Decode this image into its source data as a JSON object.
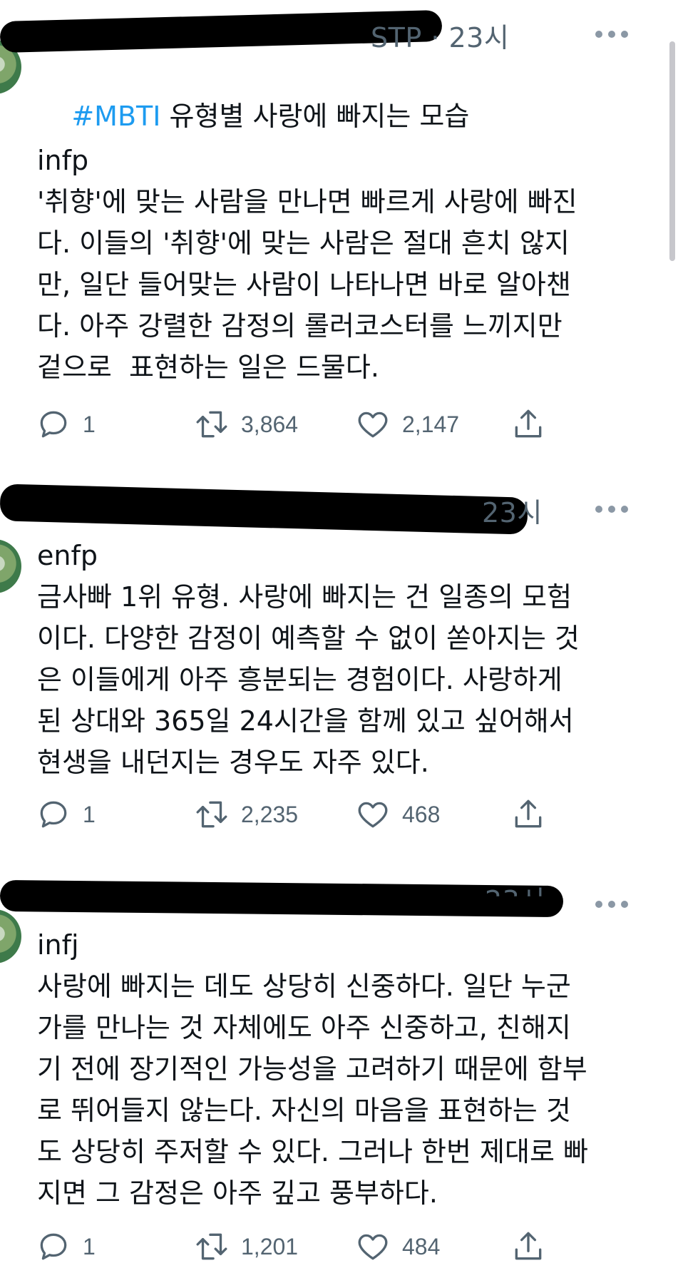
{
  "tweets": [
    {
      "time": "STP · 23시",
      "hashtag": "#MBTI",
      "title_rest": " 유형별 사랑에 빠지는 모습",
      "type": "infp",
      "text": "'취향'에 맞는 사람을 만나면 빠르게 사랑에 빠진\n다. 이들의 '취향'에 맞는 사람은 절대 흔치 않지\n만, 일단 들어맞는 사람이 나타나면 바로 알아챈\n다. 아주 강렬한 감정의 롤러코스터를 느끼지만\n겉으로  표현하는 일은 드물다.",
      "reply_count": "1",
      "retweet_count": "3,864",
      "like_count": "2,147"
    },
    {
      "time": "23시",
      "type": "enfp",
      "text": "금사빠 1위 유형. 사랑에 빠지는 건 일종의 모험\n이다. 다양한 감정이 예측할 수 없이 쏟아지는 것\n은 이들에게 아주 흥분되는 경험이다. 사랑하게\n된 상대와 365일 24시간을 함께 있고 싶어해서\n현생을 내던지는 경우도 자주 있다.",
      "reply_count": "1",
      "retweet_count": "2,235",
      "like_count": "468"
    },
    {
      "time": "23시",
      "type": "infj",
      "text": "사랑에 빠지는 데도 상당히 신중하다. 일단 누군\n가를 만나는 것 자체에도 아주 신중하고, 친해지\n기 전에 장기적인 가능성을 고려하기 때문에 함부\n로 뛰어들지 않는다. 자신의 마음을 표현하는 것\n도 상당히 주저할 수 있다. 그러나 한번 제대로 빠\n지면 그 감정은 아주 깊고 풍부하다.",
      "reply_count": "1",
      "retweet_count": "1,201",
      "like_count": "484"
    }
  ],
  "icons": {
    "reply": "reply-icon",
    "retweet": "retweet-icon",
    "like": "like-icon",
    "share": "share-icon",
    "more": "more-icon"
  },
  "colors": {
    "hashtag": "#1d9bf0",
    "meta": "#536471",
    "text": "#0f1419"
  }
}
